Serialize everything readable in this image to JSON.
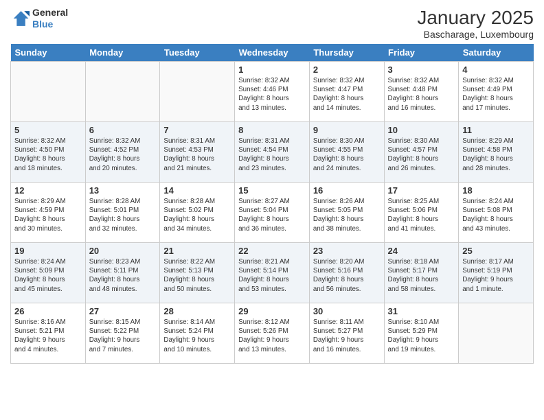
{
  "logo": {
    "general": "General",
    "blue": "Blue"
  },
  "title": "January 2025",
  "subtitle": "Bascharage, Luxembourg",
  "weekdays": [
    "Sunday",
    "Monday",
    "Tuesday",
    "Wednesday",
    "Thursday",
    "Friday",
    "Saturday"
  ],
  "weeks": [
    [
      {
        "day": "",
        "info": ""
      },
      {
        "day": "",
        "info": ""
      },
      {
        "day": "",
        "info": ""
      },
      {
        "day": "1",
        "info": "Sunrise: 8:32 AM\nSunset: 4:46 PM\nDaylight: 8 hours\nand 13 minutes."
      },
      {
        "day": "2",
        "info": "Sunrise: 8:32 AM\nSunset: 4:47 PM\nDaylight: 8 hours\nand 14 minutes."
      },
      {
        "day": "3",
        "info": "Sunrise: 8:32 AM\nSunset: 4:48 PM\nDaylight: 8 hours\nand 16 minutes."
      },
      {
        "day": "4",
        "info": "Sunrise: 8:32 AM\nSunset: 4:49 PM\nDaylight: 8 hours\nand 17 minutes."
      }
    ],
    [
      {
        "day": "5",
        "info": "Sunrise: 8:32 AM\nSunset: 4:50 PM\nDaylight: 8 hours\nand 18 minutes."
      },
      {
        "day": "6",
        "info": "Sunrise: 8:32 AM\nSunset: 4:52 PM\nDaylight: 8 hours\nand 20 minutes."
      },
      {
        "day": "7",
        "info": "Sunrise: 8:31 AM\nSunset: 4:53 PM\nDaylight: 8 hours\nand 21 minutes."
      },
      {
        "day": "8",
        "info": "Sunrise: 8:31 AM\nSunset: 4:54 PM\nDaylight: 8 hours\nand 23 minutes."
      },
      {
        "day": "9",
        "info": "Sunrise: 8:30 AM\nSunset: 4:55 PM\nDaylight: 8 hours\nand 24 minutes."
      },
      {
        "day": "10",
        "info": "Sunrise: 8:30 AM\nSunset: 4:57 PM\nDaylight: 8 hours\nand 26 minutes."
      },
      {
        "day": "11",
        "info": "Sunrise: 8:29 AM\nSunset: 4:58 PM\nDaylight: 8 hours\nand 28 minutes."
      }
    ],
    [
      {
        "day": "12",
        "info": "Sunrise: 8:29 AM\nSunset: 4:59 PM\nDaylight: 8 hours\nand 30 minutes."
      },
      {
        "day": "13",
        "info": "Sunrise: 8:28 AM\nSunset: 5:01 PM\nDaylight: 8 hours\nand 32 minutes."
      },
      {
        "day": "14",
        "info": "Sunrise: 8:28 AM\nSunset: 5:02 PM\nDaylight: 8 hours\nand 34 minutes."
      },
      {
        "day": "15",
        "info": "Sunrise: 8:27 AM\nSunset: 5:04 PM\nDaylight: 8 hours\nand 36 minutes."
      },
      {
        "day": "16",
        "info": "Sunrise: 8:26 AM\nSunset: 5:05 PM\nDaylight: 8 hours\nand 38 minutes."
      },
      {
        "day": "17",
        "info": "Sunrise: 8:25 AM\nSunset: 5:06 PM\nDaylight: 8 hours\nand 41 minutes."
      },
      {
        "day": "18",
        "info": "Sunrise: 8:24 AM\nSunset: 5:08 PM\nDaylight: 8 hours\nand 43 minutes."
      }
    ],
    [
      {
        "day": "19",
        "info": "Sunrise: 8:24 AM\nSunset: 5:09 PM\nDaylight: 8 hours\nand 45 minutes."
      },
      {
        "day": "20",
        "info": "Sunrise: 8:23 AM\nSunset: 5:11 PM\nDaylight: 8 hours\nand 48 minutes."
      },
      {
        "day": "21",
        "info": "Sunrise: 8:22 AM\nSunset: 5:13 PM\nDaylight: 8 hours\nand 50 minutes."
      },
      {
        "day": "22",
        "info": "Sunrise: 8:21 AM\nSunset: 5:14 PM\nDaylight: 8 hours\nand 53 minutes."
      },
      {
        "day": "23",
        "info": "Sunrise: 8:20 AM\nSunset: 5:16 PM\nDaylight: 8 hours\nand 56 minutes."
      },
      {
        "day": "24",
        "info": "Sunrise: 8:18 AM\nSunset: 5:17 PM\nDaylight: 8 hours\nand 58 minutes."
      },
      {
        "day": "25",
        "info": "Sunrise: 8:17 AM\nSunset: 5:19 PM\nDaylight: 9 hours\nand 1 minute."
      }
    ],
    [
      {
        "day": "26",
        "info": "Sunrise: 8:16 AM\nSunset: 5:21 PM\nDaylight: 9 hours\nand 4 minutes."
      },
      {
        "day": "27",
        "info": "Sunrise: 8:15 AM\nSunset: 5:22 PM\nDaylight: 9 hours\nand 7 minutes."
      },
      {
        "day": "28",
        "info": "Sunrise: 8:14 AM\nSunset: 5:24 PM\nDaylight: 9 hours\nand 10 minutes."
      },
      {
        "day": "29",
        "info": "Sunrise: 8:12 AM\nSunset: 5:26 PM\nDaylight: 9 hours\nand 13 minutes."
      },
      {
        "day": "30",
        "info": "Sunrise: 8:11 AM\nSunset: 5:27 PM\nDaylight: 9 hours\nand 16 minutes."
      },
      {
        "day": "31",
        "info": "Sunrise: 8:10 AM\nSunset: 5:29 PM\nDaylight: 9 hours\nand 19 minutes."
      },
      {
        "day": "",
        "info": ""
      }
    ]
  ]
}
